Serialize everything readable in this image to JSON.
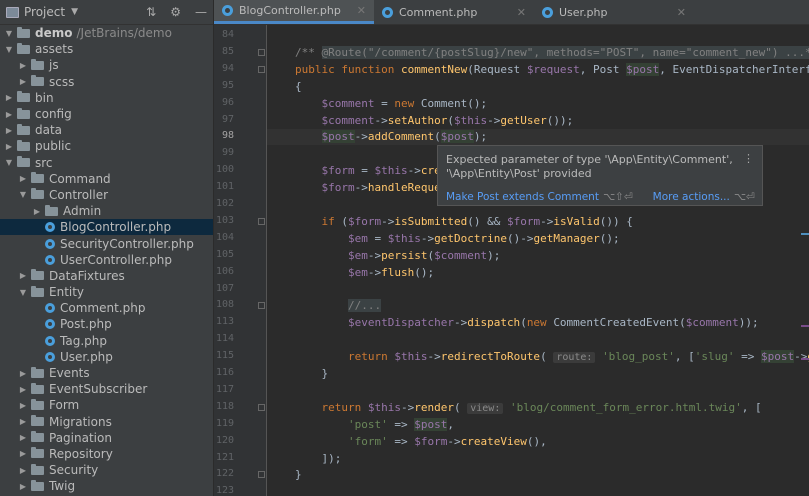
{
  "project": {
    "title": "Project"
  },
  "tree": [
    {
      "label": "demo",
      "suffix": "/JetBrains/demo",
      "type": "folder",
      "depth": 0,
      "open": true,
      "bold": true
    },
    {
      "label": "assets",
      "type": "folder",
      "depth": 0,
      "open": true
    },
    {
      "label": "js",
      "type": "folder",
      "depth": 1
    },
    {
      "label": "scss",
      "type": "folder",
      "depth": 1
    },
    {
      "label": "bin",
      "type": "folder",
      "depth": 0
    },
    {
      "label": "config",
      "type": "folder",
      "depth": 0
    },
    {
      "label": "data",
      "type": "folder",
      "depth": 0
    },
    {
      "label": "public",
      "type": "folder",
      "depth": 0
    },
    {
      "label": "src",
      "type": "folder",
      "depth": 0,
      "open": true
    },
    {
      "label": "Command",
      "type": "folder",
      "depth": 1
    },
    {
      "label": "Controller",
      "type": "folder",
      "depth": 1,
      "open": true
    },
    {
      "label": "Admin",
      "type": "folder",
      "depth": 2
    },
    {
      "label": "BlogController.php",
      "type": "file",
      "depth": 2,
      "selected": true
    },
    {
      "label": "SecurityController.php",
      "type": "file",
      "depth": 2
    },
    {
      "label": "UserController.php",
      "type": "file",
      "depth": 2
    },
    {
      "label": "DataFixtures",
      "type": "folder",
      "depth": 1
    },
    {
      "label": "Entity",
      "type": "folder",
      "depth": 1,
      "open": true
    },
    {
      "label": "Comment.php",
      "type": "file",
      "depth": 2
    },
    {
      "label": "Post.php",
      "type": "file",
      "depth": 2
    },
    {
      "label": "Tag.php",
      "type": "file",
      "depth": 2
    },
    {
      "label": "User.php",
      "type": "file",
      "depth": 2
    },
    {
      "label": "Events",
      "type": "folder",
      "depth": 1
    },
    {
      "label": "EventSubscriber",
      "type": "folder",
      "depth": 1
    },
    {
      "label": "Form",
      "type": "folder",
      "depth": 1
    },
    {
      "label": "Migrations",
      "type": "folder",
      "depth": 1
    },
    {
      "label": "Pagination",
      "type": "folder",
      "depth": 1
    },
    {
      "label": "Repository",
      "type": "folder",
      "depth": 1
    },
    {
      "label": "Security",
      "type": "folder",
      "depth": 1
    },
    {
      "label": "Twig",
      "type": "folder",
      "depth": 1
    }
  ],
  "tabs": [
    {
      "label": "BlogController.php",
      "active": true
    },
    {
      "label": "Comment.php",
      "active": false
    },
    {
      "label": "User.php",
      "active": false
    }
  ],
  "line_numbers": [
    "84",
    "85",
    "94",
    "95",
    "96",
    "97",
    "98",
    "99",
    "100",
    "101",
    "102",
    "103",
    "104",
    "105",
    "106",
    "107",
    "108",
    "113",
    "114",
    "115",
    "116",
    "117",
    "118",
    "119",
    "120",
    "121",
    "122",
    "123"
  ],
  "current_line": "98",
  "code": [
    "",
    "<span class='cm'>/** </span><span class='pill cm'>@Route(\"/comment/{postSlug}/new\", methods=\"POST\", name=\"comment_new\") ...*/</span>",
    "<span class='kw'>public function </span><span class='fn'>commentNew</span>(Request <span class='var'>$request</span>, Post <span class='var hl'>$post</span>, EventDispatcherInterface",
    "{",
    "    <span class='var'>$comment</span> = <span class='kw'>new </span>Comment();",
    "    <span class='var'>$comment</span>-><span class='fn'>setAuthor</span>(<span class='var'>$this</span>-><span class='fn'>getUser</span>());",
    "    <span class='var hl'>$post</span>-><span class='fn'>addComment</span>(<span class='var hl'>$post</span>);",
    "",
    "    <span class='var'>$form</span> = <span class='var'>$this</span>-><span class='fn'>cre</span>",
    "    <span class='var'>$form</span>-><span class='fn'>handleReque</span>",
    "",
    "    <span class='kw'>if </span>(<span class='var'>$form</span>-><span class='fn'>isSubmitted</span>() && <span class='var'>$form</span>-><span class='fn'>isValid</span>()) {",
    "        <span class='var'>$em</span> = <span class='var'>$this</span>-><span class='fn'>getDoctrine</span>()-><span class='fn'>getManager</span>();",
    "        <span class='var'>$em</span>-><span class='fn'>persist</span>(<span class='var'>$comment</span>);",
    "        <span class='var'>$em</span>-><span class='fn'>flush</span>();",
    "",
    "        <span class='pill cm'>//...</span>",
    "        <span class='var'>$eventDispatcher</span>-><span class='fn'>dispatch</span>(<span class='kw'>new </span>CommentCreatedEvent(<span class='var'>$comment</span>));",
    "",
    "        <span class='kw'>return </span><span class='var'>$this</span>-><span class='fn'>redirectToRoute</span>( <span class='hint'>route:</span> <span class='str'>'blog_post'</span>, [<span class='str'>'slug'</span> => <span class='var hl'>$post</span>-><span class='fn'>getSl</span>",
    "    }",
    "",
    "    <span class='kw'>return </span><span class='var'>$this</span>-><span class='fn'>render</span>( <span class='hint'>view:</span> <span class='str'>'blog/comment_form_error.html.twig'</span>, [",
    "        <span class='str'>'post'</span> => <span class='var hl'>$post</span>,",
    "        <span class='str'>'form'</span> => <span class='var'>$form</span>-><span class='fn'>createView</span>(),",
    "    ]);",
    "}",
    ""
  ],
  "popup": {
    "message": "Expected parameter of type '\\App\\Entity\\Comment',\n'\\App\\Entity\\Post' provided",
    "fix_label": "Make Post extends Comment",
    "fix_keys": "⌥⇧⏎",
    "more_label": "More actions...",
    "more_keys": "⌥⏎",
    "menu_glyph": "⋮"
  }
}
